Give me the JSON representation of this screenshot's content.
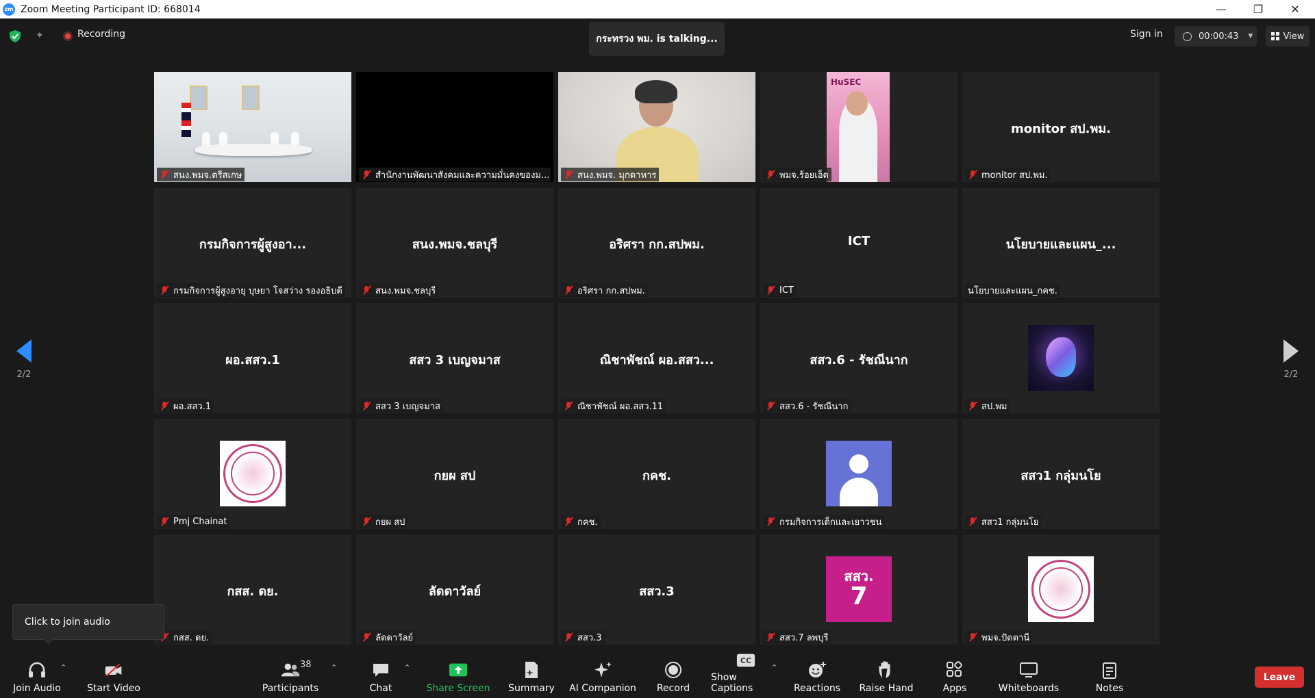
{
  "window": {
    "title": "Zoom Meeting Participant ID: 668014",
    "logo": "zm"
  },
  "topbar": {
    "recording": "Recording",
    "talking": "กระทรวง พม. is talking...",
    "sign_in": "Sign in",
    "timer": "00:00:43",
    "view": "View"
  },
  "nav": {
    "prev_page": "2/2",
    "next_page": "2/2"
  },
  "tiles": [
    {
      "name": "สนง.พมจ.ตรีสเกษ",
      "big": ""
    },
    {
      "name": "สำนักงานพัฒนาสังคมและความมั่นคงของม...",
      "big": ""
    },
    {
      "name": "สนง.พมจ. มุกดาหาร",
      "big": ""
    },
    {
      "name": "พมจ.ร้อยเอ็ด",
      "big": "",
      "banner": "HuSEC"
    },
    {
      "name": "monitor สป.พม.",
      "big": "monitor สป.พม."
    },
    {
      "name": "กรมกิจการผู้สูงอายุ บุษยา โจสว่าง รองอธิบดี",
      "big": "กรมกิจการผู้สูงอา..."
    },
    {
      "name": "สนง.พมจ.ชลบุรี",
      "big": "สนง.พมจ.ชลบุรี"
    },
    {
      "name": "อริศรา กก.สปพม.",
      "big": "อริศรา กก.สปพม."
    },
    {
      "name": "ICT",
      "big": "ICT"
    },
    {
      "name": "นโยบายและแผน_กคช.",
      "big": "นโยบายและแผน_..."
    },
    {
      "name": "ผอ.สสว.1",
      "big": "ผอ.สสว.1"
    },
    {
      "name": "สสว 3 เบญจมาส",
      "big": "สสว 3 เบญจมาส"
    },
    {
      "name": "ณิชาพัชณ์ ผอ.สสว.11",
      "big": "ณิชาพัชณ์ ผอ.สสว..."
    },
    {
      "name": "สสว.6 - รัชณีนาก",
      "big": "สสว.6 - รัชณีนาก"
    },
    {
      "name": "สป.พม",
      "big": ""
    },
    {
      "name": "Pmj Chainat",
      "big": ""
    },
    {
      "name": "กยผ สป",
      "big": "กยผ สป"
    },
    {
      "name": "กคช.",
      "big": "กคช."
    },
    {
      "name": "กรมกิจการเด็กและเยาวชน",
      "big": ""
    },
    {
      "name": "สสว1 กลุ่มนโย",
      "big": "สสว1 กลุ่มนโย"
    },
    {
      "name": "กสส. ดย.",
      "big": "กสส. ดย."
    },
    {
      "name": "ลัดดาวัลย์",
      "big": "ลัดดาวัลย์"
    },
    {
      "name": "สสว.3",
      "big": "สสว.3"
    },
    {
      "name": "สสว.7 ลพบุรี",
      "big": "",
      "badge_top": "สสว.",
      "badge_num": "7"
    },
    {
      "name": "พมจ.ปัตตานี",
      "big": ""
    }
  ],
  "tooltip": "Click to join audio",
  "toolbar": {
    "join_audio": "Join Audio",
    "start_video": "Start Video",
    "participants": "Participants",
    "participants_count": "38",
    "chat": "Chat",
    "share_screen": "Share Screen",
    "summary": "Summary",
    "ai_companion": "AI Companion",
    "record": "Record",
    "show_captions": "Show Captions",
    "reactions": "Reactions",
    "raise_hand": "Raise Hand",
    "apps": "Apps",
    "whiteboards": "Whiteboards",
    "notes": "Notes",
    "leave": "Leave",
    "cc_glyph": "CC"
  },
  "colors": {
    "accent": "#2d8cff",
    "leave": "#d4302e",
    "share": "#1fc45b",
    "muted_mic": "#e02828"
  }
}
